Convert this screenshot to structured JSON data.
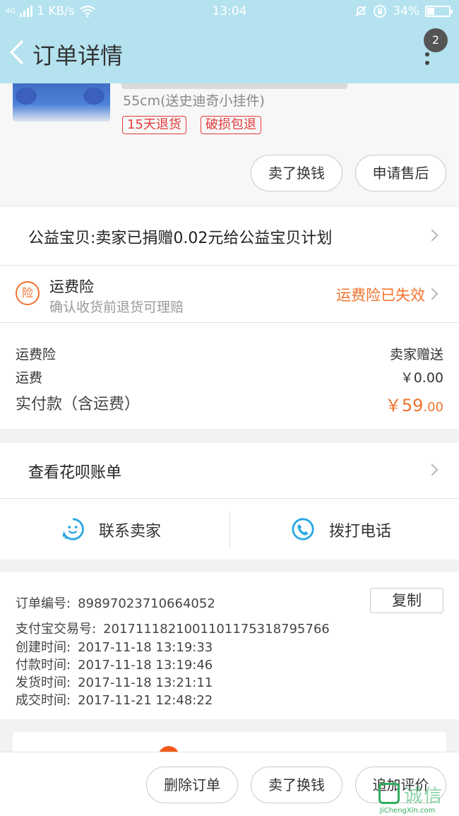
{
  "status_bar": {
    "network": "4G",
    "speed": "1 KB/s",
    "time": "13:04",
    "battery": "34%",
    "battery_level": 0.34
  },
  "header": {
    "title": "订单详情",
    "badge_count": "2"
  },
  "product": {
    "spec": "55cm(送史迪奇小挂件)",
    "tags": [
      "15天退货",
      "破损包退"
    ],
    "actions": [
      "卖了换钱",
      "申请售后"
    ]
  },
  "charity": {
    "text": "公益宝贝:卖家已捐赠0.02元给公益宝贝计划"
  },
  "insurance": {
    "icon_text": "险",
    "title": "运费险",
    "subtitle": "确认收货前退货可理赔",
    "status": "运费险已失效"
  },
  "costs": {
    "rows": [
      {
        "label": "运费险",
        "value": "卖家赠送"
      },
      {
        "label": "运费",
        "value": "￥0.00"
      }
    ],
    "total_label": "实付款（含运费）",
    "total_currency": "￥",
    "total_int": "59",
    "total_dec": ".00"
  },
  "huabei": {
    "text": "查看花呗账单"
  },
  "contact": {
    "seller": "联系卖家",
    "phone": "拨打电话"
  },
  "order_info": {
    "copy_label": "复制",
    "fields": [
      {
        "label": "订单编号:",
        "value": "89897023710664052"
      },
      {
        "label": "支付宝交易号:",
        "value": "2017111821001101175318795766"
      },
      {
        "label": "创建时间:",
        "value": "2017-11-18 13:19:33"
      },
      {
        "label": "付款时间:",
        "value": "2017-11-18 13:19:46"
      },
      {
        "label": "发货时间:",
        "value": "2017-11-18 13:21:11"
      },
      {
        "label": "成交时间:",
        "value": "2017-11-21 12:48:22"
      }
    ]
  },
  "bottom_bar": {
    "buttons": [
      "删除订单",
      "卖了换钱",
      "追加评价"
    ]
  },
  "watermark": {
    "cn": "诚信",
    "en": "JiChengXin.com"
  },
  "colors": {
    "header_bg": "#b4e2ef",
    "accent_orange": "#f0722c",
    "tag_red": "#e53b3b",
    "icon_blue": "#2aa7e3"
  }
}
